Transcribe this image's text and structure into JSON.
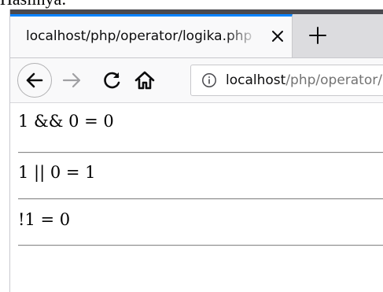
{
  "caption": "Hasilnya:",
  "browser": {
    "tab": {
      "title": "localhost/php/operator/logika.php"
    },
    "address": {
      "host": "localhost",
      "path": "/php/operator/logika.php"
    }
  },
  "output": {
    "lines": [
      "1 && 0 = 0",
      "1 || 0 = 1",
      "!1 = 0"
    ]
  },
  "icons": {
    "tab_close": "close-icon",
    "new_tab": "plus-icon",
    "back": "arrow-left-icon",
    "forward": "arrow-right-icon",
    "reload": "reload-icon",
    "home": "home-icon",
    "site_info": "info-icon"
  },
  "colors": {
    "tab_accent": "#0a84ff",
    "title_bar": "#4a4a4f"
  }
}
